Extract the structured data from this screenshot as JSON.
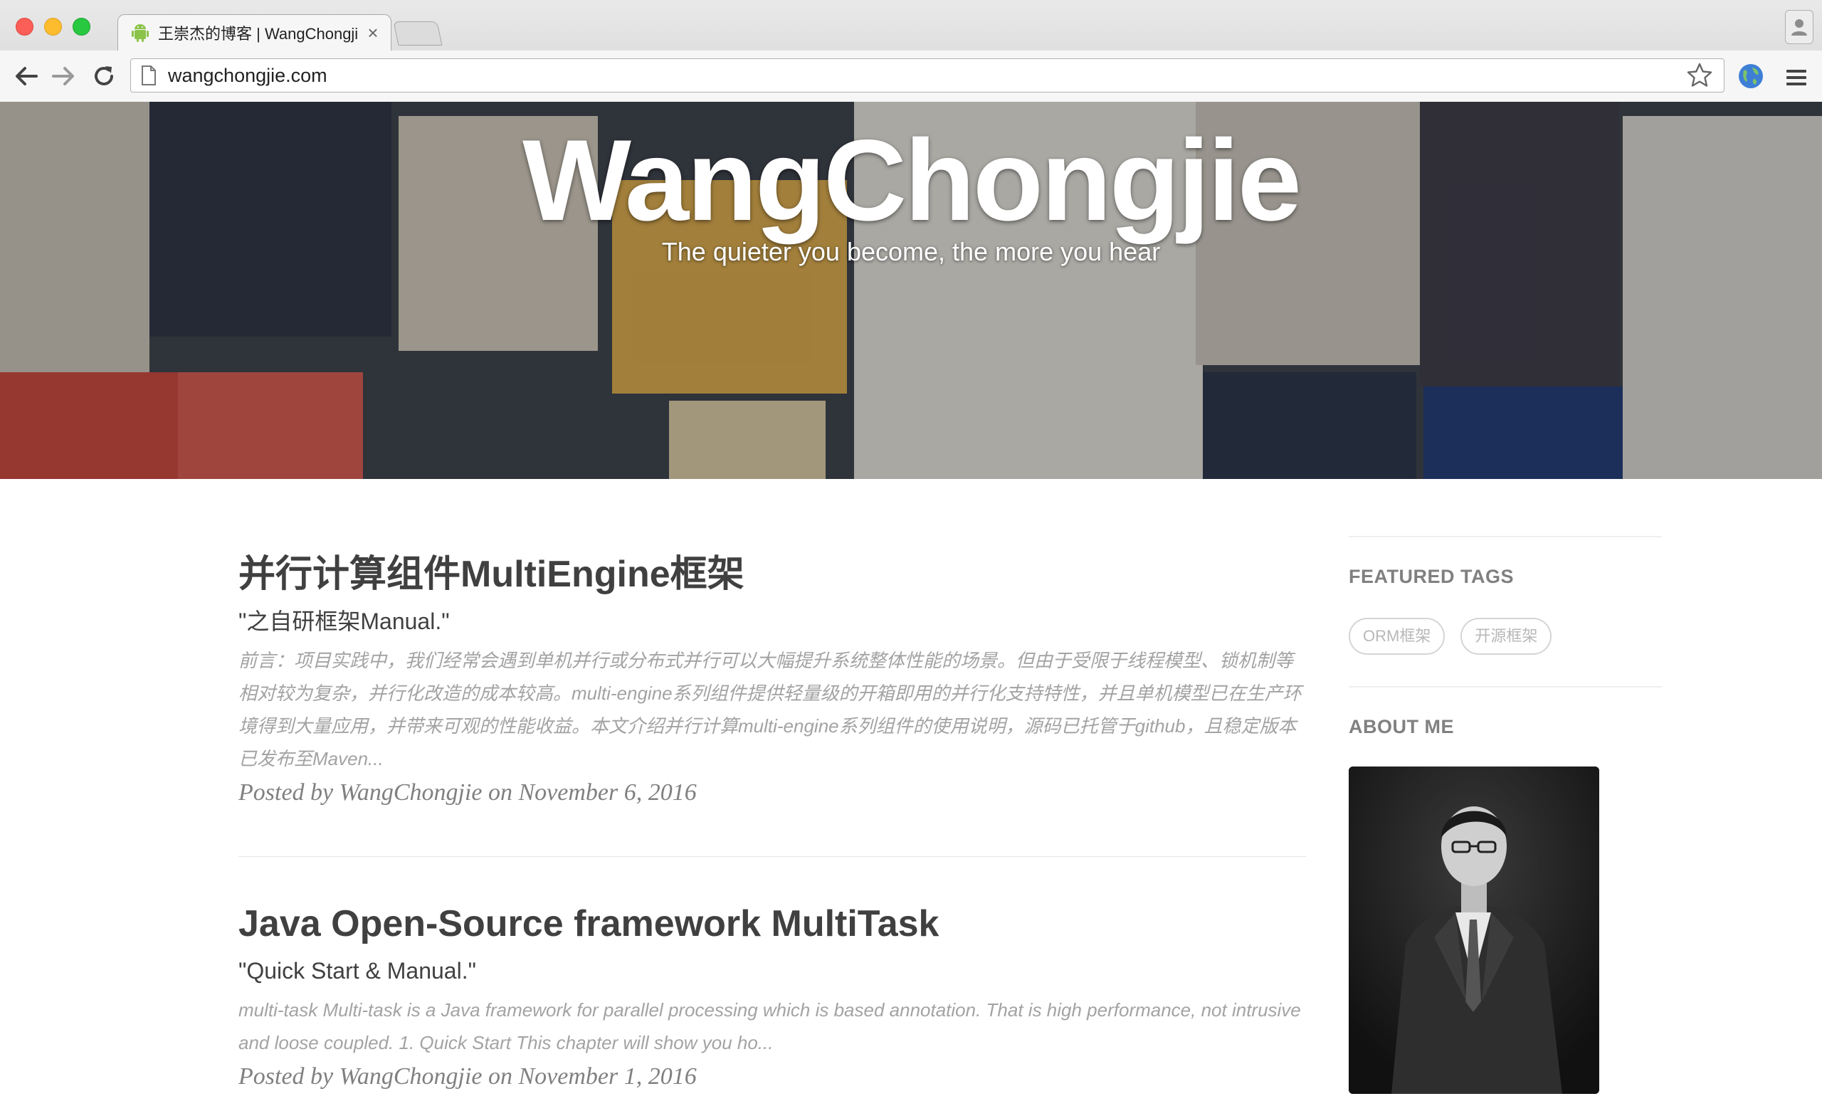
{
  "browser": {
    "tab_title": "王崇杰的博客 | WangChongjie",
    "tab_close": "×",
    "url": "wangchongjie.com",
    "icons": [
      "android-favicon-icon",
      "page-icon",
      "back-icon",
      "forward-icon",
      "reload-icon",
      "star-icon",
      "globe-extension-icon",
      "menu-icon",
      "profile-icon"
    ]
  },
  "header": {
    "title": "WangChongjie",
    "subtitle": "The quieter you become, the more you hear"
  },
  "posts": [
    {
      "title": "并行计算组件MultiEngine框架",
      "subtitle": "\"之自研框架Manual.\"",
      "excerpt": "前言：项目实践中，我们经常会遇到单机并行或分布式并行可以大幅提升系统整体性能的场景。但由于受限于线程模型、锁机制等相对较为复杂，并行化改造的成本较高。multi-engine系列组件提供轻量级的开箱即用的并行化支持特性，并且单机模型已在生产环境得到大量应用，并带来可观的性能收益。本文介绍并行计算multi-engine系列组件的使用说明，源码已托管于github，且稳定版本已发布至Maven...",
      "meta": "Posted by WangChongjie on November 6, 2016"
    },
    {
      "title": "Java Open-Source framework MultiTask",
      "subtitle": "\"Quick Start & Manual.\"",
      "excerpt": "multi-task Multi-task is a Java framework for parallel processing which is based annotation. That is high performance, not intrusive and loose coupled. 1. Quick Start This chapter will show you ho...",
      "meta": "Posted by WangChongjie on November 1, 2016"
    }
  ],
  "sidebar": {
    "featured_tags_heading": "FEATURED TAGS",
    "tags": [
      "ORM框架",
      "开源框架"
    ],
    "about_heading": "ABOUT ME"
  }
}
